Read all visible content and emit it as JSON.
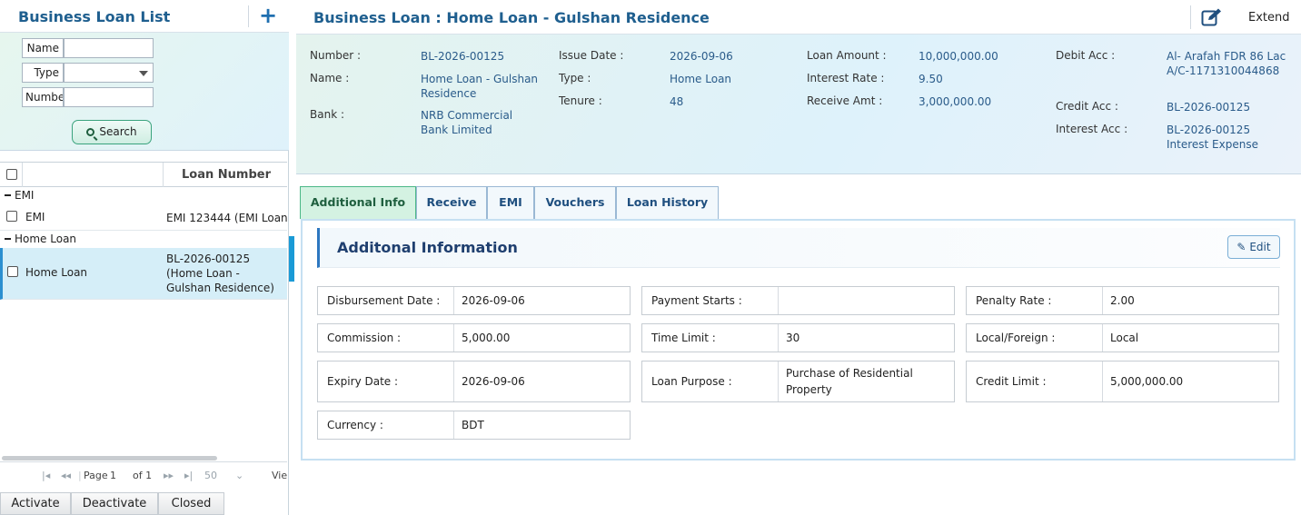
{
  "left": {
    "title": "Business Loan List",
    "filters": {
      "name_label": "Name",
      "type_label": "Type",
      "number_label": "Numbe",
      "search_label": "Search"
    },
    "grid": {
      "header_number": "Loan Number",
      "groups": [
        {
          "label": "EMI",
          "rows": [
            {
              "type": "EMI",
              "number": "EMI 123444 (EMI Loan"
            }
          ]
        },
        {
          "label": "Home Loan",
          "rows": [
            {
              "type": "Home Loan",
              "number": "BL-2026-00125 (Home Loan - Gulshan Residence)"
            }
          ]
        }
      ]
    },
    "pager": {
      "page_label": "Page",
      "page": "1",
      "of_label": "of 1",
      "page_size": "50",
      "view_label": "Vie"
    },
    "buttons": {
      "activate": "Activate",
      "deactivate": "Deactivate",
      "closed": "Closed"
    }
  },
  "right": {
    "title": "Business Loan : Home Loan - Gulshan Residence",
    "extend_label": "Extend",
    "summary": {
      "number_label": "Number :",
      "number": "BL-2026-00125",
      "name_label": "Name :",
      "name": "Home Loan - Gulshan Residence",
      "bank_label": "Bank :",
      "bank": "NRB Commercial Bank Limited",
      "issue_label": "Issue Date :",
      "issue": "2026-09-06",
      "type_label": "Type :",
      "type": "Home Loan",
      "tenure_label": "Tenure :",
      "tenure": "48",
      "amount_label": "Loan Amount :",
      "amount": "10,000,000.00",
      "rate_label": "Interest Rate :",
      "rate": "9.50",
      "receive_label": "Receive Amt :",
      "receive": "3,000,000.00",
      "debit_label": "Debit Acc :",
      "debit": "Al- Arafah FDR 86 Lac A/C-1171310044868",
      "credit_label": "Credit Acc :",
      "credit": "BL-2026-00125",
      "interest_label": "Interest Acc :",
      "interest": "BL-2026-00125 Interest Expense"
    },
    "tabs": [
      "Additional Info",
      "Receive",
      "EMI",
      "Vouchers",
      "Loan History"
    ],
    "section_title": "Additonal Information",
    "edit_label": "Edit",
    "fields": {
      "disbursement_label": "Disbursement Date :",
      "disbursement": "2026-09-06",
      "payment_label": "Payment Starts :",
      "payment": "",
      "penalty_label": "Penalty Rate :",
      "penalty": "2.00",
      "commission_label": "Commission :",
      "commission": "5,000.00",
      "timelimit_label": "Time Limit :",
      "timelimit": "30",
      "localforeign_label": "Local/Foreign :",
      "localforeign": "Local",
      "expiry_label": "Expiry Date :",
      "expiry": "2026-09-06",
      "purpose_label": "Loan Purpose :",
      "purpose": "Purchase of Residential Property",
      "creditlimit_label": "Credit Limit :",
      "creditlimit": "5,000,000.00",
      "currency_label": "Currency :",
      "currency": "BDT"
    }
  },
  "colors": {
    "brand_blue": "#1f5f8f",
    "accent_green": "#4cb887",
    "selected_row": "#d5eef8"
  }
}
